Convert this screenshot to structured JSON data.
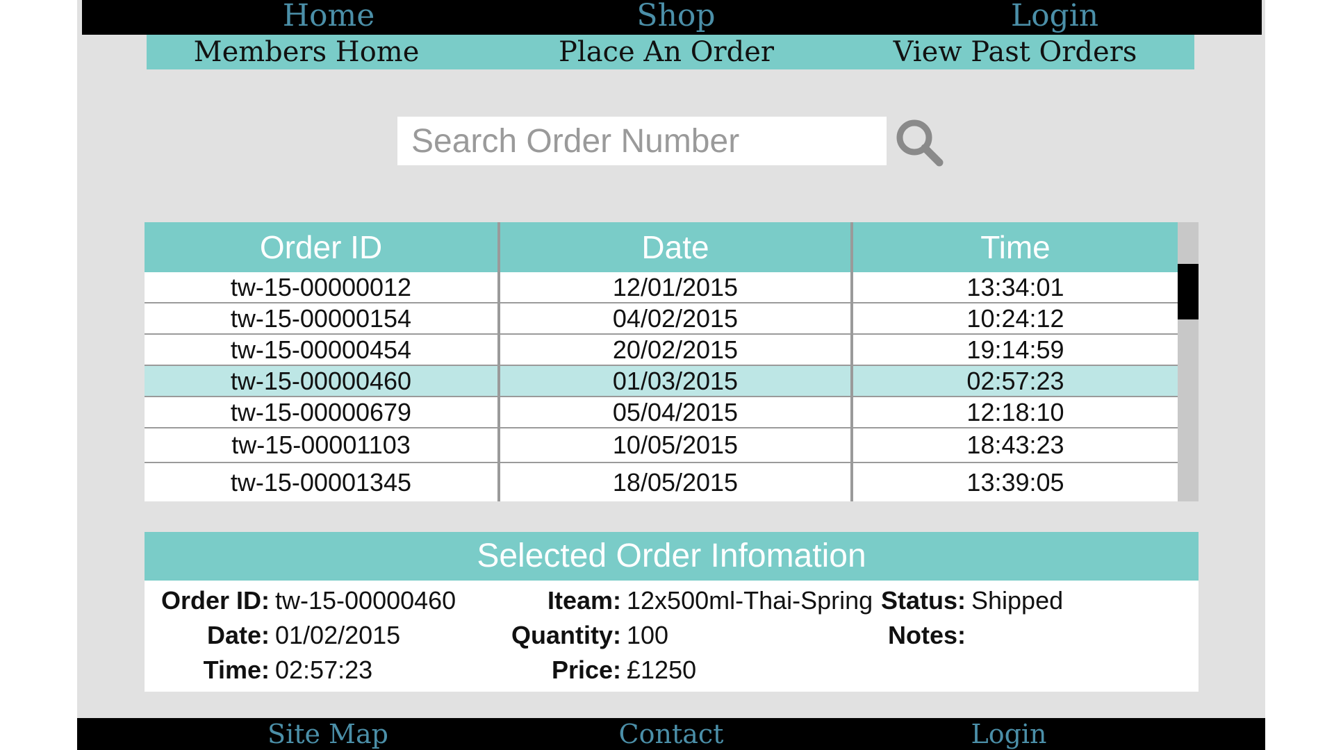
{
  "nav": {
    "home": "Home",
    "shop": "Shop",
    "login": "Login"
  },
  "subnav": {
    "members_home": "Members Home",
    "place_order": "Place An Order",
    "past_orders": "View Past Orders"
  },
  "search": {
    "placeholder": "Search Order Number",
    "icon": "magnifier-icon"
  },
  "orders": {
    "headers": [
      "Order ID",
      "Date",
      "Time"
    ],
    "rows": [
      {
        "id": "tw-15-00000012",
        "date": "12/01/2015",
        "time": "13:34:01"
      },
      {
        "id": "tw-15-00000154",
        "date": "04/02/2015",
        "time": "10:24:12"
      },
      {
        "id": "tw-15-00000454",
        "date": "20/02/2015",
        "time": "19:14:59"
      },
      {
        "id": "tw-15-00000460",
        "date": "01/03/2015",
        "time": "02:57:23"
      },
      {
        "id": "tw-15-00000679",
        "date": "05/04/2015",
        "time": "12:18:10"
      },
      {
        "id": "tw-15-00001103",
        "date": "10/05/2015",
        "time": "18:43:23"
      },
      {
        "id": "tw-15-00001345",
        "date": "18/05/2015",
        "time": "13:39:05"
      }
    ],
    "selected_index": 3
  },
  "selected": {
    "title": "Selected Order Infomation",
    "order_id_label": "Order ID:",
    "order_id": "tw-15-00000460",
    "date_label": "Date:",
    "date": "01/02/2015",
    "time_label": "Time:",
    "time": "02:57:23",
    "item_label": "Iteam:",
    "item": "12x500ml-Thai-Spring",
    "quantity_label": "Quantity:",
    "quantity": "100",
    "price_label": "Price:",
    "price": "£1250",
    "status_label": "Status:",
    "status": "Shipped",
    "notes_label": "Notes:",
    "notes": ""
  },
  "footer": {
    "site_map": "Site Map",
    "contact": "Contact",
    "login": "Login"
  },
  "colors": {
    "accent": "#7accc8",
    "selected_row": "#bde6e5",
    "nav_text": "#4b8fa8",
    "background": "#e1e1e1"
  }
}
